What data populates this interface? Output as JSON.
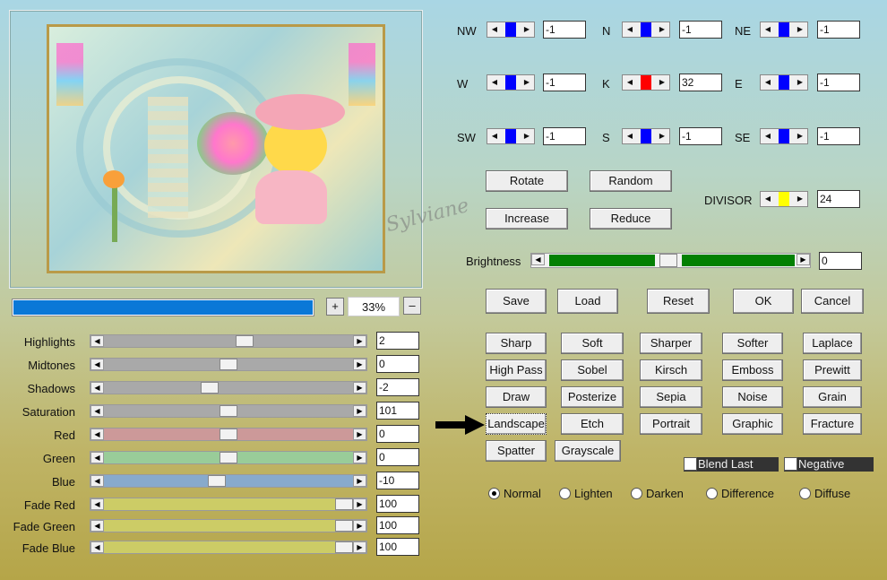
{
  "preview": {
    "zoom": "33%",
    "zoom_plus": "+",
    "zoom_minus": "–",
    "progress": 1.0,
    "watermark": "Sylviane"
  },
  "sliders": [
    {
      "label": "Highlights",
      "value": "2",
      "pos": 0.57,
      "color": "#a9a9a9"
    },
    {
      "label": "Midtones",
      "value": "0",
      "pos": 0.5,
      "color": "#a9a9a9"
    },
    {
      "label": "Shadows",
      "value": "-2",
      "pos": 0.42,
      "color": "#a9a9a9"
    },
    {
      "label": "Saturation",
      "value": "101",
      "pos": 0.5,
      "color": "#a9a9a9"
    },
    {
      "label": "Red",
      "value": "0",
      "pos": 0.5,
      "color": "#cc9999"
    },
    {
      "label": "Green",
      "value": "0",
      "pos": 0.5,
      "color": "#99cc99"
    },
    {
      "label": "Blue",
      "value": "-10",
      "pos": 0.45,
      "color": "#88aacc"
    },
    {
      "label": "Fade Red",
      "value": "100",
      "pos": 1.0,
      "color": "#cccc66"
    },
    {
      "label": "Fade Green",
      "value": "100",
      "pos": 1.0,
      "color": "#cccc66"
    },
    {
      "label": "Fade Blue",
      "value": "100",
      "pos": 1.0,
      "color": "#cccc66"
    }
  ],
  "matrix": [
    {
      "label": "NW",
      "value": "-1",
      "mark": "#0000ff"
    },
    {
      "label": "N",
      "value": "-1",
      "mark": "#0000ff"
    },
    {
      "label": "NE",
      "value": "-1",
      "mark": "#0000ff"
    },
    {
      "label": "W",
      "value": "-1",
      "mark": "#0000ff"
    },
    {
      "label": "K",
      "value": "32",
      "mark": "#ff0000"
    },
    {
      "label": "E",
      "value": "-1",
      "mark": "#0000ff"
    },
    {
      "label": "SW",
      "value": "-1",
      "mark": "#0000ff"
    },
    {
      "label": "S",
      "value": "-1",
      "mark": "#0000ff"
    },
    {
      "label": "SE",
      "value": "-1",
      "mark": "#0000ff"
    }
  ],
  "divisor": {
    "label": "DIVISOR",
    "value": "24",
    "mark": "#ffff00"
  },
  "ops": {
    "rotate": "Rotate",
    "random": "Random",
    "increase": "Increase",
    "reduce": "Reduce"
  },
  "brightness": {
    "label": "Brightness",
    "value": "0"
  },
  "actions": {
    "save": "Save",
    "load": "Load",
    "reset": "Reset",
    "ok": "OK",
    "cancel": "Cancel"
  },
  "presets": [
    [
      "Sharp",
      "Soft",
      "Sharper",
      "Softer",
      "Laplace"
    ],
    [
      "High Pass",
      "Sobel",
      "Kirsch",
      "Emboss",
      "Prewitt"
    ],
    [
      "Draw",
      "Posterize",
      "Sepia",
      "Noise",
      "Grain"
    ],
    [
      "Landscape",
      "Etch",
      "Portrait",
      "Graphic",
      "Fracture"
    ],
    [
      "Spatter",
      "Grayscale"
    ]
  ],
  "selected_preset": "Landscape",
  "checks": {
    "blend_last": "Blend Last",
    "negative": "Negative"
  },
  "modes": [
    "Normal",
    "Lighten",
    "Darken",
    "Difference",
    "Diffuse"
  ],
  "selected_mode": "Normal",
  "colors": {
    "progress": "#0a78d7",
    "bright": "#038003"
  }
}
